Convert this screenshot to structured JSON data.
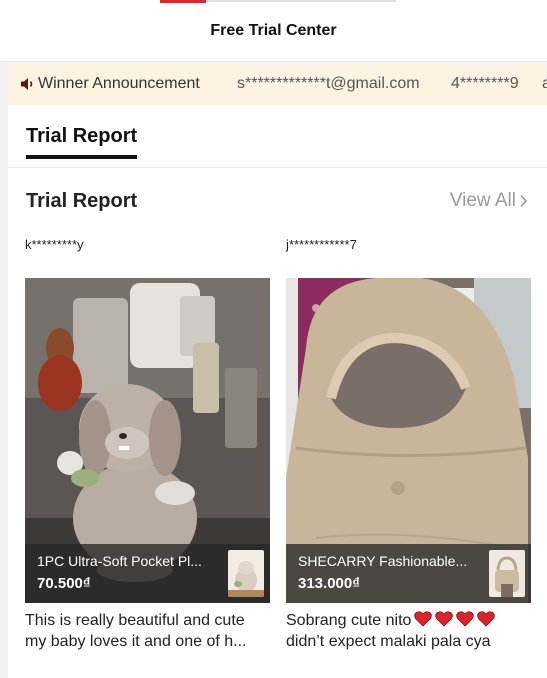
{
  "header": {
    "title": "Free Trial Center"
  },
  "announcement": {
    "icon": "speaker-icon",
    "label": "Winner Announcement",
    "winners": [
      "s*************t@gmail.com",
      "4********9",
      "a"
    ]
  },
  "tabs": [
    {
      "label": "Trial Report",
      "active": true
    }
  ],
  "section": {
    "title": "Trial Report",
    "view_all": "View All"
  },
  "reports": [
    {
      "user": "k*********y",
      "product_name": "1PC Ultra-Soft Pocket Pl...",
      "price": "70.500₫",
      "review_line1": "This is really beautiful and cute",
      "review_line2": "my baby loves it and one of h..."
    },
    {
      "user": "j************7",
      "product_name": "SHECARRY Fashionable...",
      "price": "313.000₫",
      "review_line1": "Sobrang cute nito",
      "review_line2": "didn’t expect malaki pala cya"
    }
  ],
  "colors": {
    "accent": "#e3262a",
    "announce_bg": "#fdf3e2",
    "heart": "#e0202a"
  }
}
